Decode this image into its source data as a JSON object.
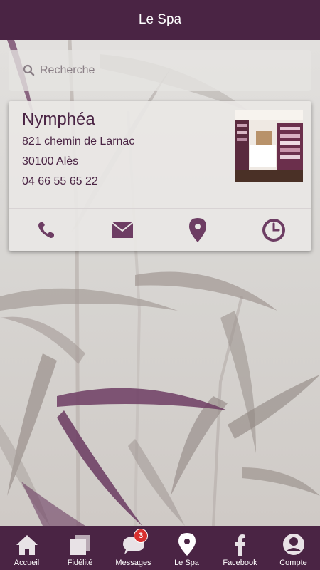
{
  "header": {
    "title": "Le Spa"
  },
  "search": {
    "placeholder": "Recherche"
  },
  "card": {
    "name": "Nymphéa",
    "address_line1": "821 chemin de Larnac",
    "address_line2": "30100 Alès",
    "phone": "04 66 55 65 22",
    "actions": [
      {
        "icon": "phone-icon"
      },
      {
        "icon": "envelope-icon"
      },
      {
        "icon": "map-pin-icon"
      },
      {
        "icon": "clock-icon"
      }
    ]
  },
  "tabbar": {
    "items": [
      {
        "label": "Accueil",
        "icon": "home-icon"
      },
      {
        "label": "Fidélité",
        "icon": "cards-icon"
      },
      {
        "label": "Messages",
        "icon": "chat-bubble-icon",
        "badge": "3"
      },
      {
        "label": "Le Spa",
        "icon": "map-pin-icon",
        "active": true
      },
      {
        "label": "Facebook",
        "icon": "facebook-icon"
      },
      {
        "label": "Compte",
        "icon": "user-icon"
      }
    ]
  },
  "colors": {
    "brand": "#4a2444",
    "accent": "#6d3d63",
    "badge": "#d9302f"
  }
}
